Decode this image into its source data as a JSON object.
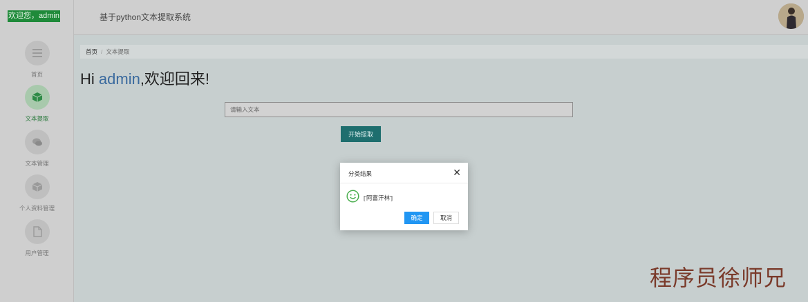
{
  "sidebar": {
    "welcome": "欢迎您，admin",
    "items": [
      {
        "label": "首页",
        "icon": "menu-icon",
        "active": false
      },
      {
        "label": "文本提取",
        "icon": "box-icon",
        "active": true
      },
      {
        "label": "文本管理",
        "icon": "chat-icon",
        "active": false
      },
      {
        "label": "个人资料管理",
        "icon": "cube-icon",
        "active": false
      },
      {
        "label": "用户管理",
        "icon": "document-icon",
        "active": false
      }
    ]
  },
  "header": {
    "title": "基于python文本提取系统"
  },
  "breadcrumb": {
    "home": "首页",
    "separator": "/",
    "current": "文本提取"
  },
  "greeting": {
    "prefix": "Hi ",
    "user": "admin",
    "suffix": ",欢迎回来!"
  },
  "input": {
    "placeholder": "请输入文本"
  },
  "start_button": "开始提取",
  "dialog": {
    "title": "分类结果",
    "result": "['阿富汗林']",
    "ok_label": "确定",
    "cancel_label": "取消"
  },
  "watermark": "程序员徐师兄",
  "colors": {
    "accent_green": "#1f8a3a",
    "button_teal": "#1e6e6e",
    "primary_blue": "#2196f3"
  }
}
